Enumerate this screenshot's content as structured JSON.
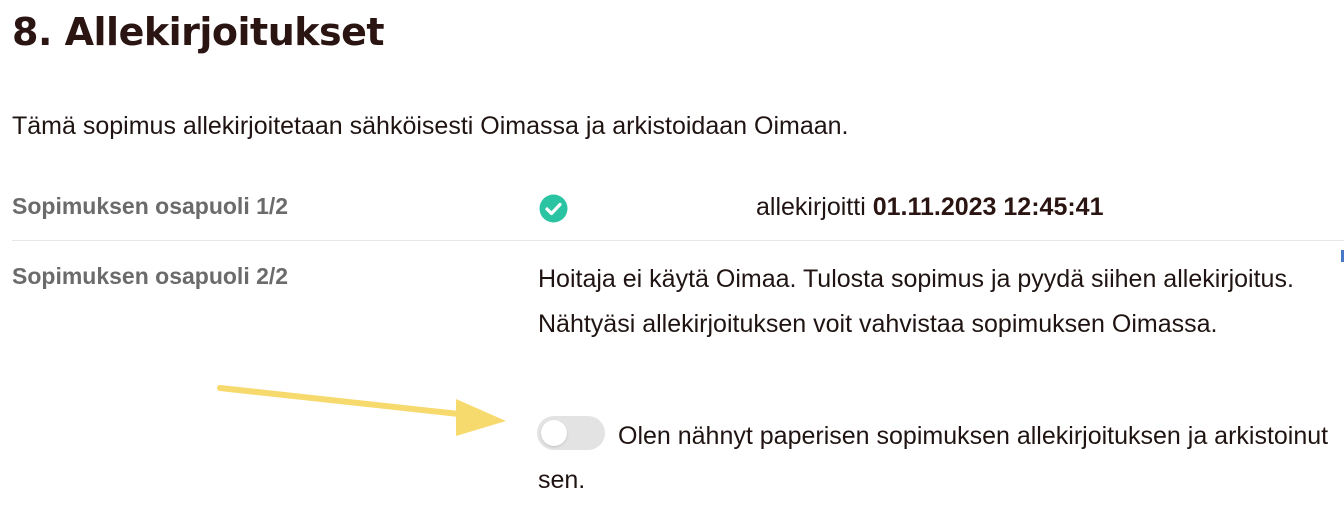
{
  "section": {
    "title": "8. Allekirjoitukset",
    "intro": "Tämä sopimus allekirjoitetaan sähköisesti Oimassa ja arkistoidaan Oimaan."
  },
  "party1": {
    "label": "Sopimuksen osapuoli 1/2",
    "status_icon": "check-circle-icon",
    "status_color": "#2bc4a3",
    "signed_prefix": "allekirjoitti",
    "signed_datetime": "01.11.2023 12:45:41"
  },
  "party2": {
    "label": "Sopimuksen osapuoli 2/2",
    "info": "Hoitaja ei käytä Oimaa. Tulosta sopimus ja pyydä siihen allekirjoitus. Nähtyäsi allekirjoituksen voit vahvistaa sopimuksen Oimassa.",
    "toggle_on": false,
    "toggle_label": "Olen nähnyt paperisen sopimuksen allekirjoituksen ja arkistoinut sen."
  },
  "annotation": {
    "arrow_color": "#f7da6e"
  }
}
